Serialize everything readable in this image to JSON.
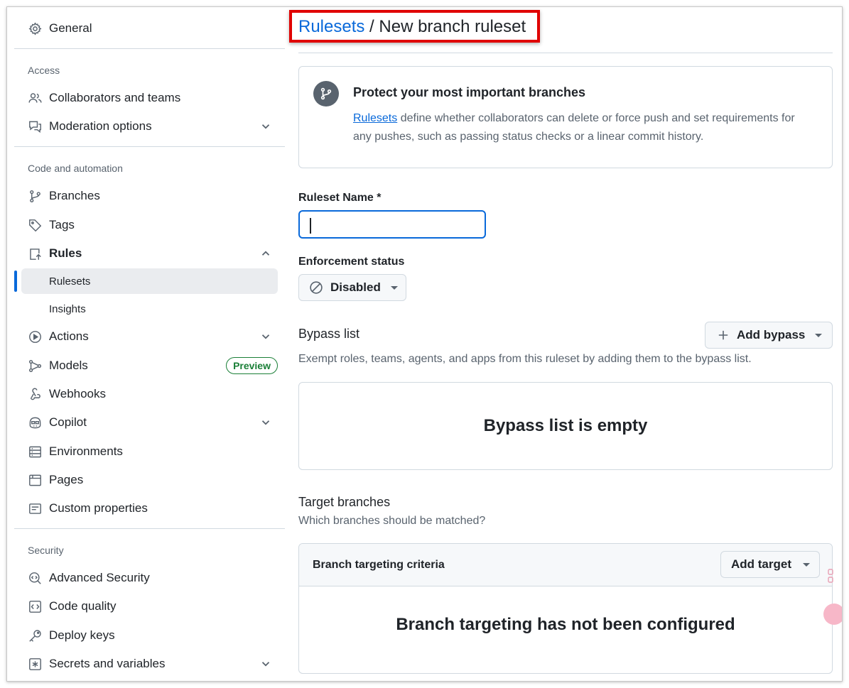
{
  "sidebar": {
    "general": "General",
    "sections": {
      "access": "Access",
      "code_automation": "Code and automation",
      "security": "Security"
    },
    "items": {
      "collaborators": "Collaborators and teams",
      "moderation": "Moderation options",
      "branches": "Branches",
      "tags": "Tags",
      "rules": "Rules",
      "rulesets": "Rulesets",
      "insights": "Insights",
      "actions": "Actions",
      "models": "Models",
      "models_badge": "Preview",
      "webhooks": "Webhooks",
      "copilot": "Copilot",
      "environments": "Environments",
      "pages": "Pages",
      "custom_properties": "Custom properties",
      "advanced_security": "Advanced Security",
      "code_quality": "Code quality",
      "deploy_keys": "Deploy keys",
      "secrets": "Secrets and variables"
    },
    "accent_color": "#0969da"
  },
  "breadcrumb": {
    "link": "Rulesets",
    "separator": " / ",
    "current": "New branch ruleset"
  },
  "callout": {
    "title": "Protect your most important branches",
    "link": "Rulesets",
    "text": " define whether collaborators can delete or force push and set requirements for any pushes, such as passing status checks or a linear commit history."
  },
  "form": {
    "ruleset_name_label": "Ruleset Name *",
    "ruleset_name_value": "",
    "enforcement_label": "Enforcement status",
    "enforcement_value": "Disabled"
  },
  "bypass": {
    "title": "Bypass list",
    "button": "Add bypass",
    "description": "Exempt roles, teams, agents, and apps from this ruleset by adding them to the bypass list.",
    "empty": "Bypass list is empty"
  },
  "targets": {
    "title": "Target branches",
    "description": "Which branches should be matched?",
    "criteria": "Branch targeting criteria",
    "button": "Add target",
    "empty": "Branch targeting has not been configured"
  }
}
